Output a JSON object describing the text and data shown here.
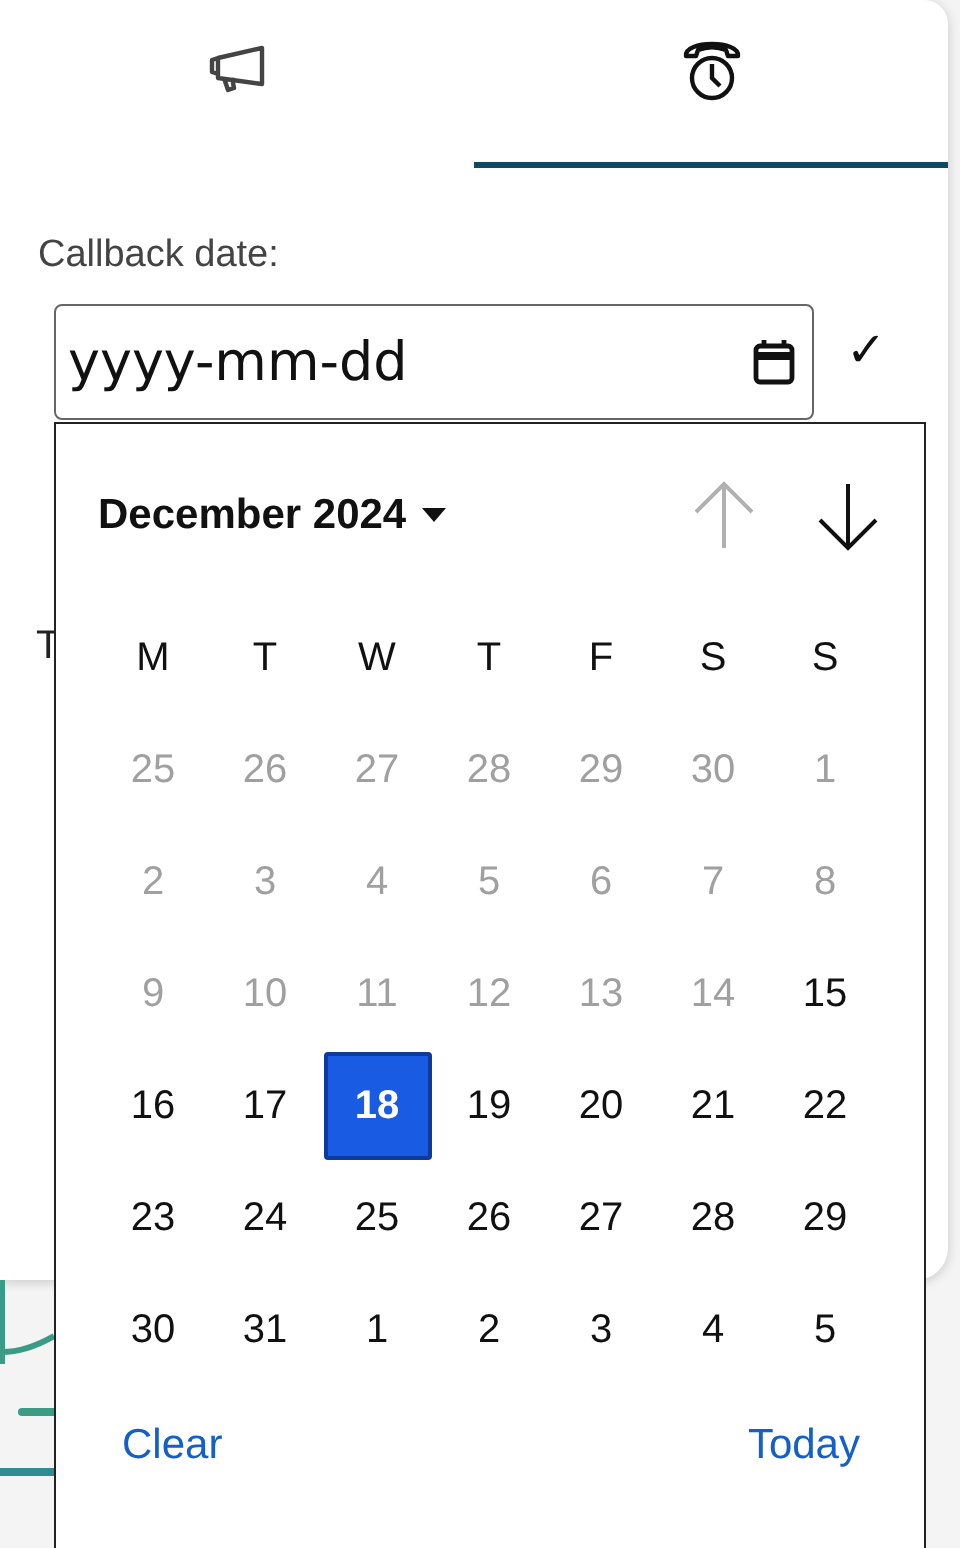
{
  "tabs": [
    {
      "kind": "megaphone",
      "selected": false
    },
    {
      "kind": "phone-clock",
      "selected": true
    }
  ],
  "callback": {
    "label": "Callback date:",
    "placeholder": "yyyy-mm-dd",
    "confirm": "✓"
  },
  "hidden_label": "T",
  "calendar": {
    "month": "December 2024",
    "prev_disabled": true,
    "next_disabled": false,
    "weekdays": [
      "M",
      "T",
      "W",
      "T",
      "F",
      "S",
      "S"
    ],
    "weeks": [
      [
        {
          "day": "25",
          "disabled": true,
          "selected": false
        },
        {
          "day": "26",
          "disabled": true,
          "selected": false
        },
        {
          "day": "27",
          "disabled": true,
          "selected": false
        },
        {
          "day": "28",
          "disabled": true,
          "selected": false
        },
        {
          "day": "29",
          "disabled": true,
          "selected": false
        },
        {
          "day": "30",
          "disabled": true,
          "selected": false
        },
        {
          "day": "1",
          "disabled": true,
          "selected": false
        }
      ],
      [
        {
          "day": "2",
          "disabled": true,
          "selected": false
        },
        {
          "day": "3",
          "disabled": true,
          "selected": false
        },
        {
          "day": "4",
          "disabled": true,
          "selected": false
        },
        {
          "day": "5",
          "disabled": true,
          "selected": false
        },
        {
          "day": "6",
          "disabled": true,
          "selected": false
        },
        {
          "day": "7",
          "disabled": true,
          "selected": false
        },
        {
          "day": "8",
          "disabled": true,
          "selected": false
        }
      ],
      [
        {
          "day": "9",
          "disabled": true,
          "selected": false
        },
        {
          "day": "10",
          "disabled": true,
          "selected": false
        },
        {
          "day": "11",
          "disabled": true,
          "selected": false
        },
        {
          "day": "12",
          "disabled": true,
          "selected": false
        },
        {
          "day": "13",
          "disabled": true,
          "selected": false
        },
        {
          "day": "14",
          "disabled": true,
          "selected": false
        },
        {
          "day": "15",
          "disabled": false,
          "selected": false
        }
      ],
      [
        {
          "day": "16",
          "disabled": false,
          "selected": false
        },
        {
          "day": "17",
          "disabled": false,
          "selected": false
        },
        {
          "day": "18",
          "disabled": false,
          "selected": true
        },
        {
          "day": "19",
          "disabled": false,
          "selected": false
        },
        {
          "day": "20",
          "disabled": false,
          "selected": false
        },
        {
          "day": "21",
          "disabled": false,
          "selected": false
        },
        {
          "day": "22",
          "disabled": false,
          "selected": false
        }
      ],
      [
        {
          "day": "23",
          "disabled": false,
          "selected": false
        },
        {
          "day": "24",
          "disabled": false,
          "selected": false
        },
        {
          "day": "25",
          "disabled": false,
          "selected": false
        },
        {
          "day": "26",
          "disabled": false,
          "selected": false
        },
        {
          "day": "27",
          "disabled": false,
          "selected": false
        },
        {
          "day": "28",
          "disabled": false,
          "selected": false
        },
        {
          "day": "29",
          "disabled": false,
          "selected": false
        }
      ],
      [
        {
          "day": "30",
          "disabled": false,
          "selected": false
        },
        {
          "day": "31",
          "disabled": false,
          "selected": false
        },
        {
          "day": "1",
          "disabled": false,
          "selected": false
        },
        {
          "day": "2",
          "disabled": false,
          "selected": false
        },
        {
          "day": "3",
          "disabled": false,
          "selected": false
        },
        {
          "day": "4",
          "disabled": false,
          "selected": false
        },
        {
          "day": "5",
          "disabled": false,
          "selected": false
        }
      ]
    ],
    "clear": "Clear",
    "today": "Today"
  }
}
